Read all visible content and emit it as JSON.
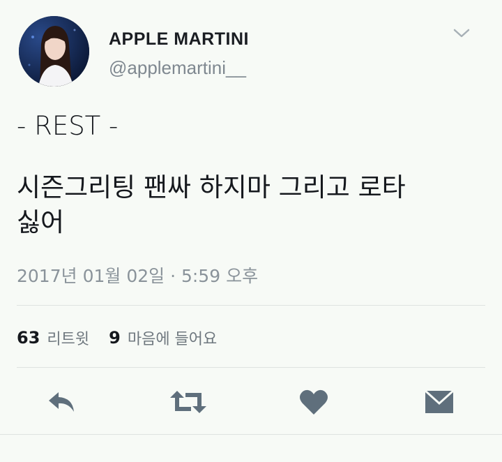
{
  "user": {
    "display_name": "APPLE MARTINI",
    "handle": "@applemartini__"
  },
  "tweet": {
    "lines": [
      "- REST -",
      "시즌그리팅 팬싸 하지마 그리고 로타",
      "싫어"
    ],
    "timestamp": "2017년 01월 02일 · 5:59 오후"
  },
  "stats": {
    "retweets_count": "63",
    "retweets_label": "리트윗",
    "likes_count": "9",
    "likes_label": "마음에 들어요"
  },
  "icons": {
    "menu": "chevron-down-icon",
    "reply": "reply-icon",
    "retweet": "retweet-icon",
    "like": "heart-icon",
    "dm": "envelope-icon"
  },
  "colors": {
    "background": "#f7faf6",
    "icon": "#5f6f7c",
    "muted_text": "#8a939a"
  }
}
